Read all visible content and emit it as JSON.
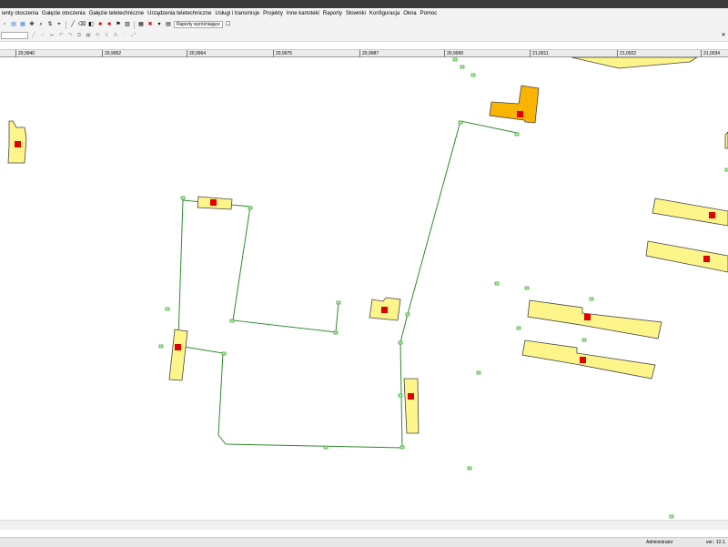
{
  "menu": [
    "ienty otoczenia",
    "Gałęzie otoczenia",
    "Gałęzie teletechniczne",
    "Urządzenia teletechniczne",
    "Usługi i transmisje",
    "Projekty",
    "Inne kartoteki",
    "Raporty",
    "Słowniki",
    "Konfiguracja",
    "Okna",
    "Pomoc"
  ],
  "toolbar": {
    "reports_label": "Raporty wyróżniające",
    "zoom_label": "⇔"
  },
  "ruler": {
    "labels": [
      "20,9940",
      "20,9952",
      "20,9964",
      "20,9975",
      "20,9987",
      "20,9999",
      "21,0011",
      "21,0022",
      "21,0034"
    ]
  },
  "status": {
    "user": "Administrator",
    "version": "ver.: 12.1."
  },
  "colors": {
    "building_fill": "#fdf58a",
    "building_selected_fill": "#f8b400",
    "building_marker": "#e00000",
    "network_line": "#2e8b2e",
    "node_fill": "#b6f0a0",
    "node_stroke": "#4ba84b"
  },
  "icons": [
    "new-icon",
    "open-icon",
    "select-icon",
    "pan-icon",
    "zoom-icon",
    "measure-icon",
    "snap-icon",
    "layer-icon",
    "draw-line-icon",
    "draw-point-icon",
    "stop-icon",
    "delete-icon"
  ]
}
